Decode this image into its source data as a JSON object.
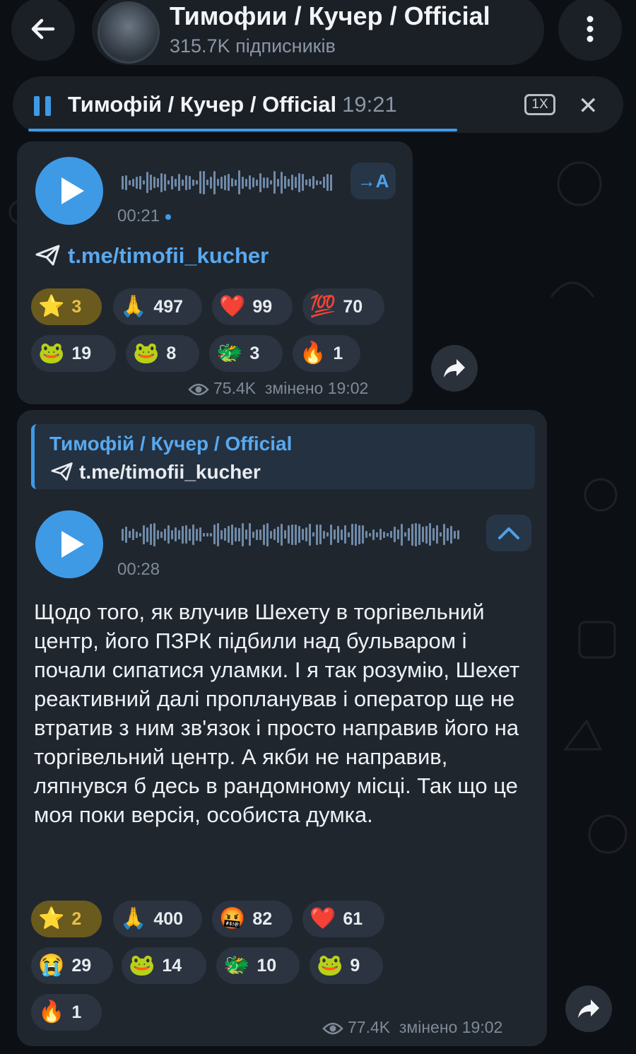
{
  "header": {
    "channel_title": "Тимофии / Кучер / Official",
    "subscribers": "315.7K підписників"
  },
  "player": {
    "title": "Тимофій / Кучер / Official",
    "time": "19:21",
    "speed": "1X",
    "progress_percent": 71
  },
  "message1": {
    "duration": "00:21",
    "transcribe_label": "→A",
    "link": "t.me/timofii_kucher",
    "reactions": [
      {
        "emoji": "⭐",
        "count": "3",
        "gold": true
      },
      {
        "emoji": "🙏",
        "count": "497"
      },
      {
        "emoji": "❤️",
        "count": "99"
      },
      {
        "emoji": "💯",
        "count": "70"
      },
      {
        "emoji": "🐸",
        "count": "19"
      },
      {
        "emoji": "🐸",
        "count": "8"
      },
      {
        "emoji": "🐲",
        "count": "3"
      },
      {
        "emoji": "🔥",
        "count": "1"
      }
    ],
    "views": "75.4K",
    "edited": "змінено 19:02"
  },
  "message2": {
    "quote_title": "Тимофій / Кучер / Official",
    "quote_link": "t.me/timofii_kucher",
    "duration": "00:28",
    "text": "Щодо того, як влучив Шехету в торгівельний центр, його ПЗРК підбили над бульваром і почали сипатися уламки. І я так розумію, Шехет реактивний далі пропланував і оператор ще не втратив з ним зв'язок і просто направив його на торгівельний центр. А якби не направив, ляпнувся б десь в рандомному місці. Так що це моя поки версія, особиста думка.",
    "reactions": [
      {
        "emoji": "⭐",
        "count": "2",
        "gold": true
      },
      {
        "emoji": "🙏",
        "count": "400"
      },
      {
        "emoji": "🤬",
        "count": "82"
      },
      {
        "emoji": "❤️",
        "count": "61"
      },
      {
        "emoji": "😭",
        "count": "29"
      },
      {
        "emoji": "🐸",
        "count": "14"
      },
      {
        "emoji": "🐲",
        "count": "10"
      },
      {
        "emoji": "🐸",
        "count": "9"
      },
      {
        "emoji": "🔥",
        "count": "1"
      }
    ],
    "views": "77.4K",
    "edited": "змінено 19:02"
  },
  "colors": {
    "accent": "#3f9ae6",
    "bubble": "#20262e",
    "background": "#0c0f14"
  }
}
